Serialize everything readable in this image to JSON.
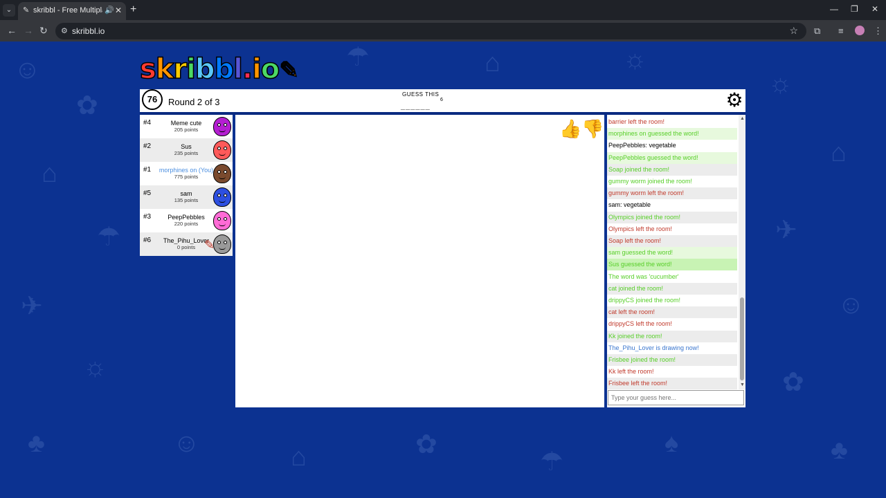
{
  "browser": {
    "tab_title": "skribbl - Free Multiplayer D",
    "url": "skribbl.io",
    "icons": {
      "tab_dropdown": "chevron-down-icon",
      "favicon": "pencil-icon",
      "audio": "speaker-icon",
      "close": "close-icon",
      "new_tab": "plus-icon"
    }
  },
  "logo": {
    "letters": [
      "s",
      "k",
      "r",
      "i",
      "b",
      "b",
      "l",
      ".",
      "i",
      "o"
    ],
    "colors": [
      "#ff3b30",
      "#ff9500",
      "#ffcc00",
      "#4cd964",
      "#5ac8fa",
      "#007aff",
      "#5856d6",
      "#ff2d55",
      "#ff9500",
      "#4cd964"
    ]
  },
  "game": {
    "timer": "76",
    "round_text": "Round 2 of 3",
    "guess_label": "GUESS THIS",
    "word_hint": "______",
    "word_length": "6"
  },
  "players": [
    {
      "rank": "#4",
      "name": "Meme cute",
      "points": "205 points",
      "color": "#b41fd1",
      "me": false
    },
    {
      "rank": "#2",
      "name": "Sus",
      "points": "235 points",
      "color": "#ff5a5a",
      "me": false
    },
    {
      "rank": "#1",
      "name": "morphines on (You)",
      "points": "775 points",
      "color": "#7a4a2e",
      "me": true
    },
    {
      "rank": "#5",
      "name": "sam",
      "points": "135 points",
      "color": "#2d4fe0",
      "me": false
    },
    {
      "rank": "#3",
      "name": "PeepPebbles",
      "points": "220 points",
      "color": "#ff6bd6",
      "me": false
    },
    {
      "rank": "#6",
      "name": "The_Pihu_Lover",
      "points": "0 points",
      "color": "#9a9a9a",
      "me": false
    }
  ],
  "chat": [
    {
      "text": "barrier left the room!",
      "color": "#c0392b",
      "bg": "#ffffff"
    },
    {
      "text": "morphines on guessed the word!",
      "color": "#56ce27",
      "bg": "#e7f9dd"
    },
    {
      "who": "PeepPebbles:",
      "text": " vegetable",
      "color": "#000000",
      "bg": "#ffffff"
    },
    {
      "text": "PeepPebbles guessed the word!",
      "color": "#56ce27",
      "bg": "#e7f9dd"
    },
    {
      "text": "Soap joined the room!",
      "color": "#56ce27",
      "bg": "#ececec"
    },
    {
      "text": "gummy worm joined the room!",
      "color": "#56ce27",
      "bg": "#ffffff"
    },
    {
      "text": "gummy worm left the room!",
      "color": "#c0392b",
      "bg": "#ececec"
    },
    {
      "who": "sam:",
      "text": " vegetable",
      "color": "#000000",
      "bg": "#ffffff"
    },
    {
      "text": "Olympics joined the room!",
      "color": "#56ce27",
      "bg": "#ececec"
    },
    {
      "text": "Olympics left the room!",
      "color": "#c0392b",
      "bg": "#ffffff"
    },
    {
      "text": "Soap left the room!",
      "color": "#c0392b",
      "bg": "#ececec"
    },
    {
      "text": "sam guessed the word!",
      "color": "#56ce27",
      "bg": "#e7f9dd"
    },
    {
      "text": "Sus guessed the word!",
      "color": "#56ce27",
      "bg": "#c8f3b4"
    },
    {
      "text": "The word was 'cucumber'",
      "color": "#56ce27",
      "bg": "#ffffff"
    },
    {
      "text": "cat joined the room!",
      "color": "#56ce27",
      "bg": "#ececec"
    },
    {
      "text": "drippyCS joined the room!",
      "color": "#56ce27",
      "bg": "#ffffff"
    },
    {
      "text": "cat left the room!",
      "color": "#c0392b",
      "bg": "#ececec"
    },
    {
      "text": "drippyCS left the room!",
      "color": "#c0392b",
      "bg": "#ffffff"
    },
    {
      "text": "Kk joined the room!",
      "color": "#56ce27",
      "bg": "#ececec"
    },
    {
      "text": "The_Pihu_Lover is drawing now!",
      "color": "#3975ce",
      "bg": "#ffffff"
    },
    {
      "text": "Frisbee joined the room!",
      "color": "#56ce27",
      "bg": "#ececec"
    },
    {
      "text": "Kk left the room!",
      "color": "#c0392b",
      "bg": "#ffffff"
    },
    {
      "text": "Frisbee left the room!",
      "color": "#c0392b",
      "bg": "#ececec"
    }
  ],
  "input": {
    "placeholder": "Type your guess here..."
  }
}
